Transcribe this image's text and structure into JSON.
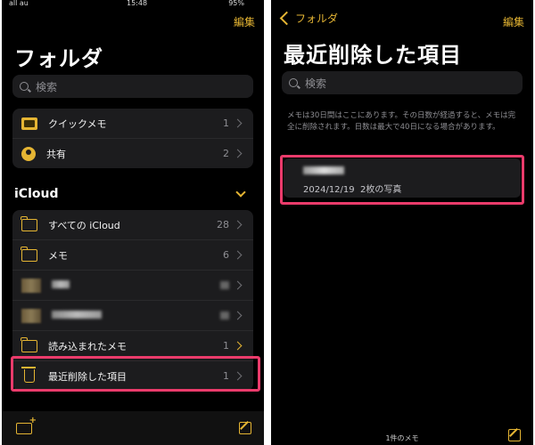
{
  "left": {
    "status_left": "all au",
    "status_time": "15:48",
    "status_right": "95%",
    "edit_label": "編集",
    "title": "フォルダ",
    "search_placeholder": "検索",
    "top_group": [
      {
        "label": "クイックメモ",
        "count": "1",
        "icon": "quick-memo-icon"
      },
      {
        "label": "共有",
        "count": "2",
        "icon": "shared-person-icon"
      }
    ],
    "icloud_header": "iCloud",
    "icloud_group": [
      {
        "label": "すべての iCloud",
        "count": "28"
      },
      {
        "label": "メモ",
        "count": "6"
      },
      {
        "label": "読み込まれたメモ",
        "count": "1"
      },
      {
        "label": "最近削除した項目",
        "count": "1"
      }
    ]
  },
  "right": {
    "back_label": "フォルダ",
    "edit_label": "編集",
    "title": "最近削除した項目",
    "search_placeholder": "検索",
    "info_text": "メモは30日間はここにあります。その日数が経過すると、メモは完全に削除されます。日数は最大で40日になる場合があります。",
    "note": {
      "date": "2024/12/19",
      "meta": "2枚の写真"
    },
    "footer_count": "1件のメモ"
  },
  "colors": {
    "accent": "#e5b533",
    "highlight": "#ea3b6b",
    "background": "#000000",
    "card": "#1c1c1e"
  }
}
